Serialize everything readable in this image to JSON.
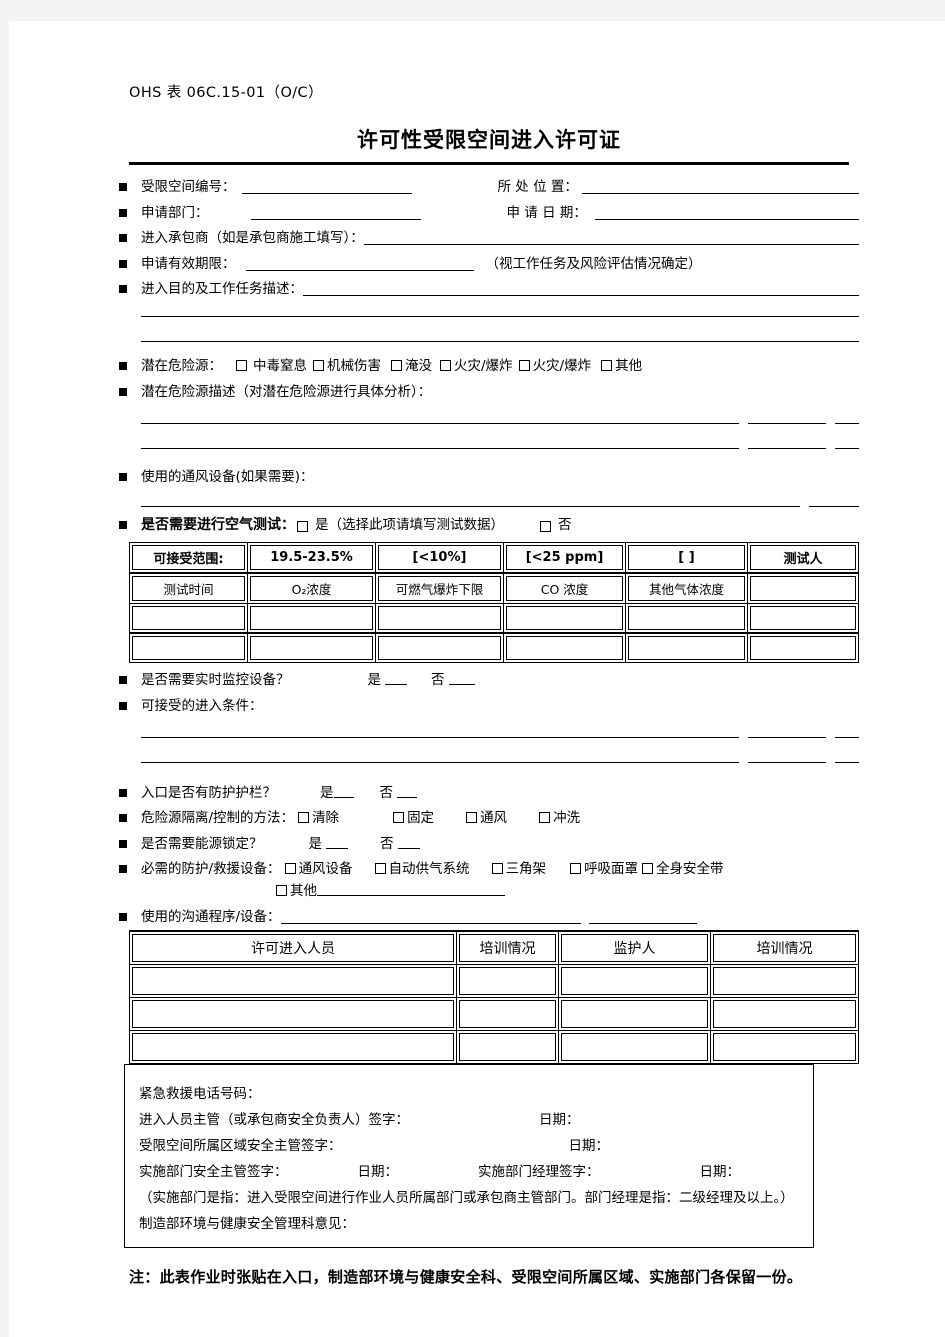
{
  "document": {
    "form_code": "OHS 表 06C.15-01（O/C）",
    "title": "许可性受限空间进入许可证"
  },
  "fields": {
    "space_no_label": "受限空间编号：",
    "location_label": "所 处 位 置：",
    "dept_label": "申请部门：",
    "apply_date_label": "申 请 日 期：",
    "contractor_label": "进入承包商（如是承包商施工填写）：",
    "validity_label": "申请有效期限：",
    "validity_note": "（视工作任务及风险评估情况确定）",
    "purpose_label": "进入目的及工作任务描述：",
    "hazard_label": "潜在危险源：",
    "hazard_desc_label": "潜在危险源描述（对潜在危险源进行具体分析）：",
    "ventilation_label": "使用的通风设备(如果需要)：",
    "air_test_label": "是否需要进行空气测试：",
    "air_test_yes": "是（选择此项请填写测试数据）",
    "air_test_no": "否",
    "monitor_label": "是否需要实时监控设备？",
    "monitor_yes": "是",
    "monitor_no": "否",
    "entry_conditions_label": "可接受的进入条件：",
    "guardrail_label": "入口是否有防护护栏？",
    "guardrail_yes": "是",
    "guardrail_no": "否",
    "isolation_label": "危险源隔离/控制的方法：",
    "lockout_label": "是否需要能源锁定？",
    "lockout_yes": "是",
    "lockout_no": "否",
    "ppe_label": "必需的防护/救援设备：",
    "ppe_other": "其他",
    "comm_label": "使用的沟通程序/设备："
  },
  "hazard_options": [
    "中毒窒息",
    "机械伤害",
    "淹没",
    "火灾/爆炸",
    "火灾/爆炸",
    "其他"
  ],
  "isolation_options": [
    "清除",
    "固定",
    "通风",
    "冲洗"
  ],
  "ppe_options": [
    "通风设备",
    "自动供气系统",
    "三角架",
    "呼吸面罩",
    "全身安全带"
  ],
  "air_test_table": {
    "header": {
      "range_label": "可接受范围:",
      "o2_range": "19.5-23.5%",
      "lel_range": "[<10%]",
      "co_range": "[<25 ppm]",
      "other_range": "[        ]",
      "tester": "测试人"
    },
    "subheader": [
      "测试时间",
      "O₂浓度",
      "可燃气爆炸下限",
      "CO 浓度",
      "其他气体浓度",
      ""
    ],
    "blank_rows": 2
  },
  "people_table": {
    "headers": [
      "许可进入人员",
      "培训情况",
      "监护人",
      "培训情况"
    ],
    "blank_rows": 3
  },
  "signature_block": {
    "emergency_phone": "紧急救援电话号码：",
    "supervisor_sign": "进入人员主管（或承包商安全负责人）签字：",
    "supervisor_date": "日期：",
    "area_safety_sign": "受限空间所属区域安全主管签字：",
    "area_safety_date": "日期：",
    "dept_safety_sign": "实施部门安全主管签字：",
    "dept_safety_date": "日期：",
    "dept_manager_sign": "实施部门经理签字：",
    "dept_manager_date": "日期：",
    "explanation": "（实施部门是指：进入受限空间进行作业人员所属部门或承包商主管部门。部门经理是指：二级经理及以上。）",
    "ehs_opinion": "制造部环境与健康安全管理科意见："
  },
  "footer_note": "注：此表作业时张贴在入口，制造部环境与健康安全科、受限空间所属区域、实施部门各保留一份。"
}
